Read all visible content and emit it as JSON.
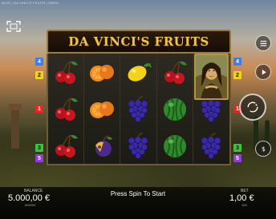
{
  "window": {
    "title": "BLUE | DA VINCI'S FRUITS | DEMO"
  },
  "game": {
    "title": "DA VINCI'S FRUITS"
  },
  "reels": [
    [
      "cherry",
      "cherry",
      "cherry"
    ],
    [
      "orange",
      "orange",
      "plum"
    ],
    [
      "lemon",
      "grapes",
      "grapes"
    ],
    [
      "cherry",
      "watermelon",
      "watermelon"
    ],
    [
      "mona-lisa",
      "grapes",
      "grapes"
    ]
  ],
  "paylines": {
    "left": [
      {
        "label": "4",
        "color": "#3f7de8"
      },
      {
        "label": "2",
        "color": "#f2d21f"
      },
      {
        "label": "1",
        "color": "#e02a24"
      },
      {
        "label": "3",
        "color": "#3ec23e"
      },
      {
        "label": "5",
        "color": "#8e3fd6"
      }
    ],
    "right": [
      {
        "label": "4",
        "color": "#3f7de8"
      },
      {
        "label": "2",
        "color": "#f2d21f"
      },
      {
        "label": "1",
        "color": "#e02a24"
      },
      {
        "label": "3",
        "color": "#3ec23e"
      },
      {
        "label": "5",
        "color": "#8e3fd6"
      }
    ]
  },
  "controls": {
    "menu_icon": "hamburger-icon",
    "play_icon": "play-icon",
    "spin_icon": "spin-icon",
    "bet_icon": "dollar-icon",
    "expand_icon": "fullscreen-icon"
  },
  "footer": {
    "balance_label": "BALANCE",
    "balance_value": "5.000,00 €",
    "balance_sub": "500000",
    "message": "Press Spin To Start",
    "bet_label": "BET",
    "bet_value": "1,00 €",
    "bet_sub": "100"
  }
}
